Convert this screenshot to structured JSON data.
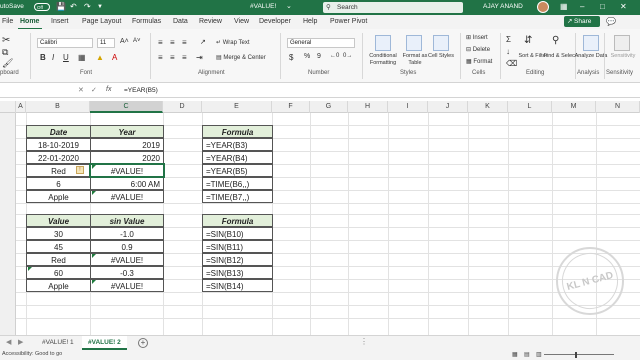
{
  "titlebar": {
    "autosave_label": "utoSave",
    "autosave_state": "Off",
    "save_icon": "save-icon",
    "undo_icon": "undo-icon",
    "redo_icon": "redo-icon",
    "more_icon": "chevron-down-icon",
    "workbook_name": "#VALUE!",
    "search_placeholder": "Search",
    "user_name": "AJAY ANAND",
    "colors": {
      "bar": "#217346"
    }
  },
  "tabs": [
    "File",
    "Home",
    "Insert",
    "Page Layout",
    "Formulas",
    "Data",
    "Review",
    "View",
    "Developer",
    "Help",
    "Power Pivot"
  ],
  "share_label": "Share",
  "ribbon": {
    "clipboard": {
      "group": "pboard"
    },
    "font": {
      "group": "Font",
      "font_name": "Calibri",
      "font_size": "11",
      "bold": "B",
      "italic": "I",
      "underline": "U"
    },
    "alignment": {
      "group": "Alignment",
      "wrap_text": "Wrap Text",
      "merge_center": "Merge & Center"
    },
    "number": {
      "group": "Number",
      "format": "General",
      "currency": "$",
      "percent": "%",
      "comma": "9"
    },
    "styles": {
      "group": "Styles",
      "conditional": "Conditional Formatting",
      "format_table": "Format as Table",
      "cell_styles": "Cell Styles"
    },
    "cells": {
      "group": "Cells",
      "insert": "Insert",
      "delete": "Delete",
      "format": "Format"
    },
    "editing": {
      "group": "Editing",
      "sort_filter": "Sort & Filter",
      "find_select": "Find & Select"
    },
    "analysis": {
      "group": "Analysis",
      "analyze_data": "Analyze Data"
    },
    "sensitivity": {
      "group": "Sensitivity",
      "label": "Sensitivity"
    }
  },
  "formula_bar": {
    "fx": "fx",
    "formula": "=YEAR(B5)"
  },
  "columns": [
    "A",
    "B",
    "C",
    "D",
    "E",
    "F",
    "G",
    "H",
    "I",
    "J",
    "K",
    "L",
    "M",
    "N"
  ],
  "selected_column": "C",
  "table1": {
    "headers": [
      "Date",
      "Year"
    ],
    "rows": [
      [
        "18-10-2019",
        "2019"
      ],
      [
        "22-01-2020",
        "2020"
      ],
      [
        "Red",
        "#VALUE!"
      ],
      [
        "6",
        "6:00 AM"
      ],
      [
        "Apple",
        "#VALUE!"
      ]
    ]
  },
  "formulas1": {
    "header": "Formula",
    "rows": [
      "=YEAR(B3)",
      "=YEAR(B4)",
      "=YEAR(B5)",
      "=TIME(B6,,)",
      "=TIME(B7,,)"
    ]
  },
  "table2": {
    "headers": [
      "Value",
      "sin Value"
    ],
    "rows": [
      [
        "30",
        "-1.0"
      ],
      [
        "45",
        "0.9"
      ],
      [
        "Red",
        "#VALUE!"
      ],
      [
        "60",
        "-0.3"
      ],
      [
        "Apple",
        "#VALUE!"
      ]
    ]
  },
  "formulas2": {
    "header": "Formula",
    "rows": [
      "=SIN(B10)",
      "=SIN(B11)",
      "=SIN(B12)",
      "=SIN(B13)",
      "=SIN(B14)"
    ]
  },
  "watermark": {
    "text": "KL N CAD"
  },
  "sheets": [
    "#VALUE! 1",
    "#VALUE! 2"
  ],
  "active_sheet": "#VALUE! 2",
  "status": {
    "accessibility": "Accessibility: Good to go"
  }
}
